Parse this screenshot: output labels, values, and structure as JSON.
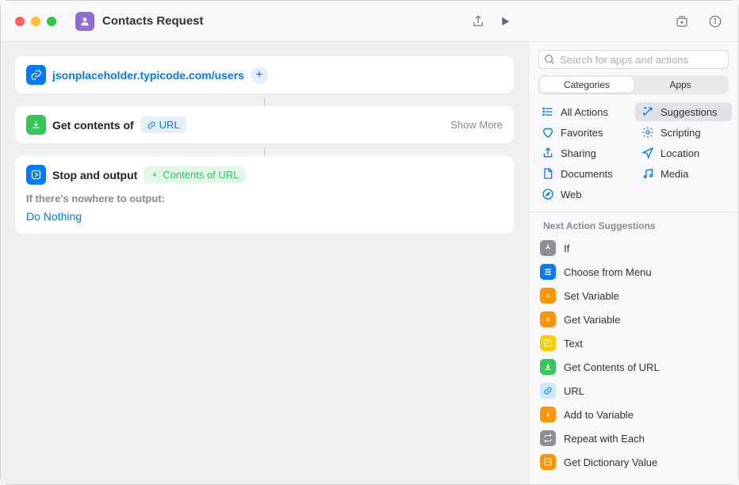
{
  "window": {
    "title": "Contacts Request"
  },
  "actions": {
    "url_card": {
      "url": "jsonplaceholder.typicode.com/users"
    },
    "get_contents": {
      "title": "Get contents of",
      "token_label": "URL",
      "show_more": "Show More"
    },
    "stop_output": {
      "title": "Stop and output",
      "token_label": "Contents of URL",
      "nowhere_label": "If there's nowhere to output:",
      "do_nothing": "Do Nothing"
    }
  },
  "sidebar": {
    "search_placeholder": "Search for apps and actions",
    "segmented": {
      "categories": "Categories",
      "apps": "Apps"
    },
    "categories": [
      {
        "label": "All Actions",
        "icon": "list"
      },
      {
        "label": "Favorites",
        "icon": "heart"
      },
      {
        "label": "Sharing",
        "icon": "share"
      },
      {
        "label": "Documents",
        "icon": "doc"
      },
      {
        "label": "Web",
        "icon": "safari"
      },
      {
        "label": "Suggestions",
        "icon": "wand",
        "selected": true
      },
      {
        "label": "Scripting",
        "icon": "gear"
      },
      {
        "label": "Location",
        "icon": "nav"
      },
      {
        "label": "Media",
        "icon": "music"
      }
    ],
    "suggest_header": "Next Action Suggestions",
    "suggestions": [
      {
        "label": "If",
        "color": "si-gray",
        "icon": "branch"
      },
      {
        "label": "Choose from Menu",
        "color": "si-blue",
        "icon": "menu"
      },
      {
        "label": "Set Variable",
        "color": "si-orange",
        "icon": "x"
      },
      {
        "label": "Get Variable",
        "color": "si-orange",
        "icon": "x"
      },
      {
        "label": "Text",
        "color": "si-yellow",
        "icon": "text"
      },
      {
        "label": "Get Contents of URL",
        "color": "si-green",
        "icon": "download"
      },
      {
        "label": "URL",
        "color": "si-lblue",
        "icon": "link"
      },
      {
        "label": "Add to Variable",
        "color": "si-orange",
        "icon": "x"
      },
      {
        "label": "Repeat with Each",
        "color": "si-gray",
        "icon": "repeat"
      },
      {
        "label": "Get Dictionary Value",
        "color": "si-orange",
        "icon": "dict"
      }
    ]
  }
}
